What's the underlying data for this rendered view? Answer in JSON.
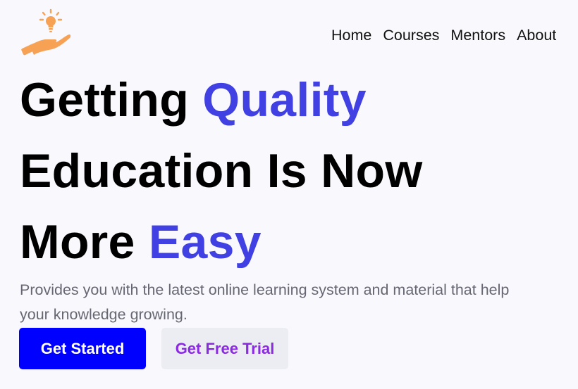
{
  "brand": {
    "logo_icon": "lightbulb-hand-icon",
    "logo_color": "#f7a154"
  },
  "nav": {
    "items": [
      "Home",
      "Courses",
      "Mentors",
      "About"
    ]
  },
  "hero": {
    "line1_a": "Getting ",
    "line1_b": "Quality",
    "line2": "Education Is Now",
    "line3_a": "More ",
    "line3_b": "Easy",
    "accent_color": "#4040e3",
    "subtitle": "Provides you with the latest online learning system and material that help your knowledge growing."
  },
  "buttons": {
    "primary": "Get Started",
    "secondary": "Get Free Trial",
    "primary_color": "#0000ff",
    "secondary_text_color": "#8a2be2"
  }
}
